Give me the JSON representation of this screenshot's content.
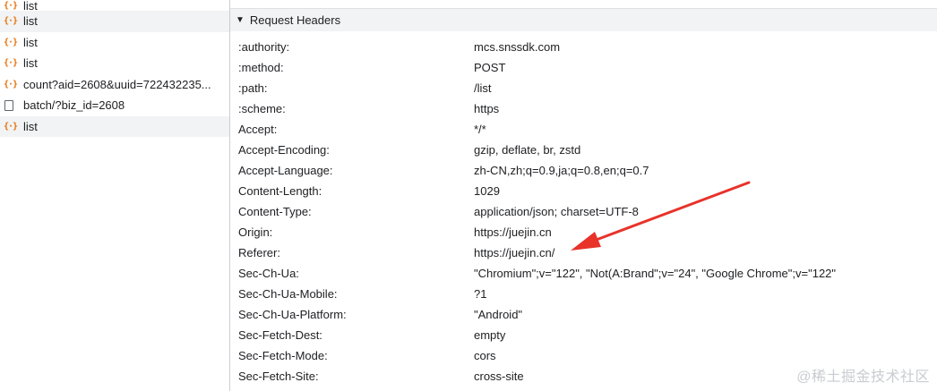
{
  "requests": [
    {
      "name": "list",
      "icon": "json-icon",
      "alt": false
    },
    {
      "name": "list",
      "icon": "json-icon",
      "alt": true
    },
    {
      "name": "list",
      "icon": "json-icon",
      "alt": false
    },
    {
      "name": "list",
      "icon": "json-icon",
      "alt": false
    },
    {
      "name": "count?aid=2608&uuid=722432235...",
      "icon": "json-icon",
      "alt": false
    },
    {
      "name": "batch/?biz_id=2608",
      "icon": "document-icon",
      "alt": false
    },
    {
      "name": "list",
      "icon": "json-icon",
      "alt": true
    }
  ],
  "section": {
    "title": "Request Headers"
  },
  "headers": [
    {
      "name": ":authority:",
      "value": "mcs.snssdk.com"
    },
    {
      "name": ":method:",
      "value": "POST"
    },
    {
      "name": ":path:",
      "value": "/list"
    },
    {
      "name": ":scheme:",
      "value": "https"
    },
    {
      "name": "Accept:",
      "value": "*/*"
    },
    {
      "name": "Accept-Encoding:",
      "value": "gzip, deflate, br, zstd"
    },
    {
      "name": "Accept-Language:",
      "value": "zh-CN,zh;q=0.9,ja;q=0.8,en;q=0.7"
    },
    {
      "name": "Content-Length:",
      "value": "1029"
    },
    {
      "name": "Content-Type:",
      "value": "application/json; charset=UTF-8"
    },
    {
      "name": "Origin:",
      "value": "https://juejin.cn"
    },
    {
      "name": "Referer:",
      "value": "https://juejin.cn/"
    },
    {
      "name": "Sec-Ch-Ua:",
      "value": "\"Chromium\";v=\"122\", \"Not(A:Brand\";v=\"24\", \"Google Chrome\";v=\"122\""
    },
    {
      "name": "Sec-Ch-Ua-Mobile:",
      "value": "?1"
    },
    {
      "name": "Sec-Ch-Ua-Platform:",
      "value": "\"Android\""
    },
    {
      "name": "Sec-Fetch-Dest:",
      "value": "empty"
    },
    {
      "name": "Sec-Fetch-Mode:",
      "value": "cors"
    },
    {
      "name": "Sec-Fetch-Site:",
      "value": "cross-site"
    }
  ],
  "annotation": {
    "arrow_color": "#e8322a",
    "points_to": "Referer"
  },
  "watermark": "@稀土掘金技术社区"
}
